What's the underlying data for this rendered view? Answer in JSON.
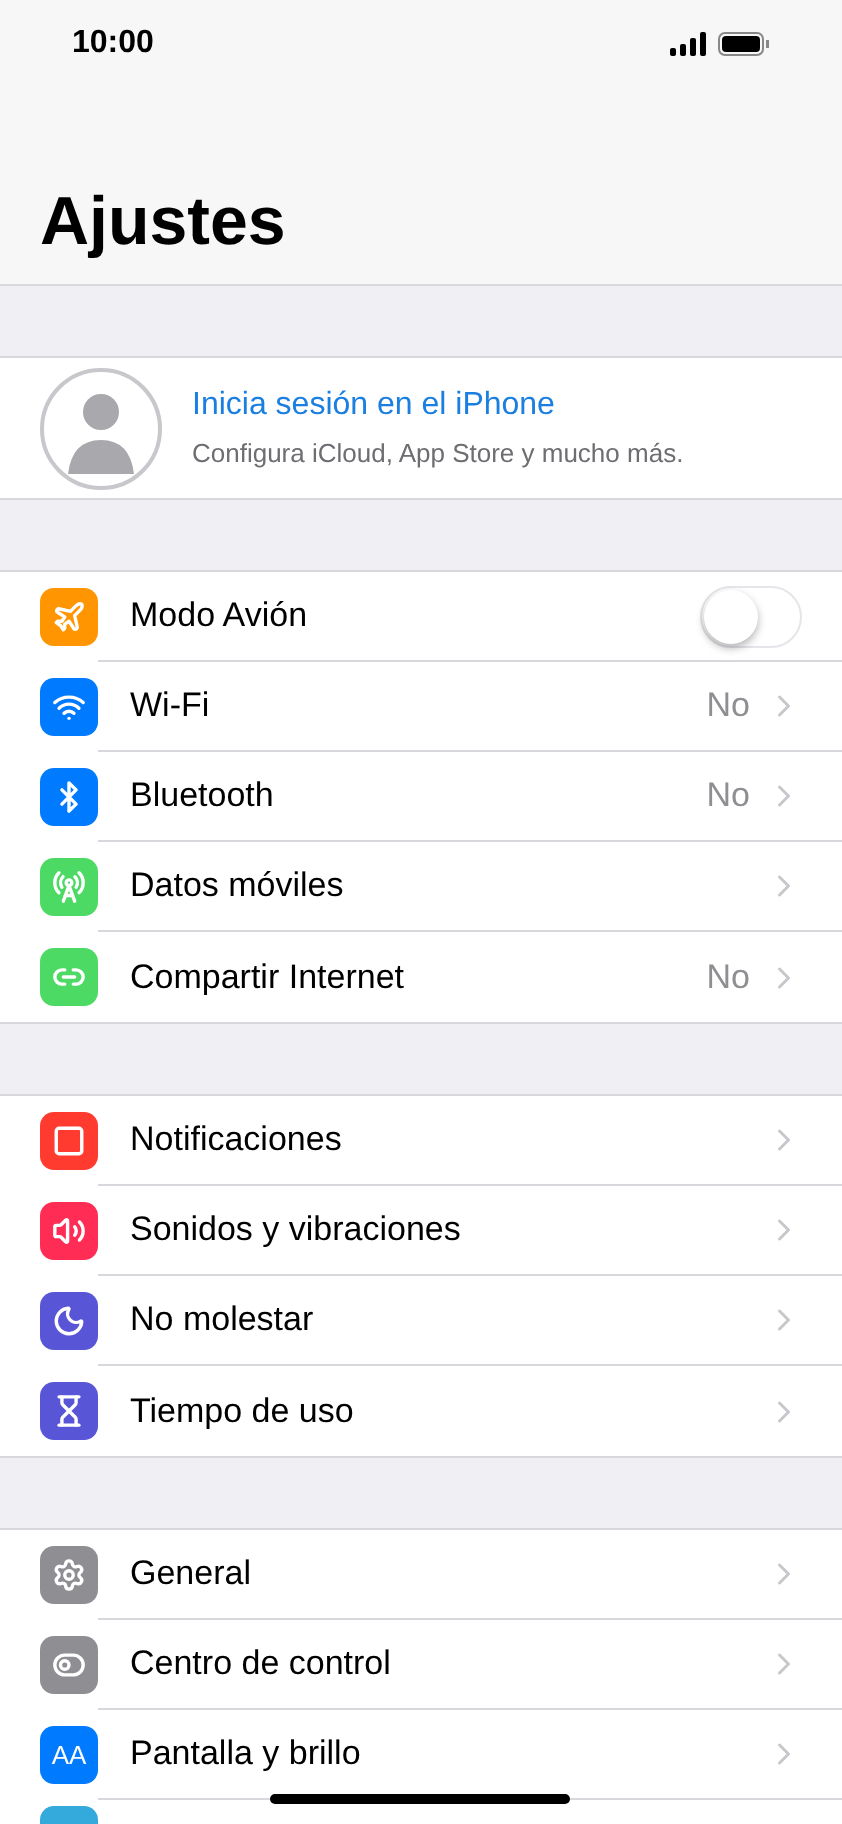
{
  "status_bar": {
    "time": "10:00"
  },
  "title": "Ajustes",
  "account": {
    "title": "Inicia sesión en el iPhone",
    "subtitle": "Configura iCloud, App Store y mucho más."
  },
  "sections": [
    {
      "items": [
        {
          "kind": "toggle",
          "label": "Modo Avión",
          "on": false,
          "color": "#ff9500"
        },
        {
          "kind": "link",
          "label": "Wi-Fi",
          "value": "No",
          "color": "#007aff"
        },
        {
          "kind": "link",
          "label": "Bluetooth",
          "value": "No",
          "color": "#007aff"
        },
        {
          "kind": "link",
          "label": "Datos móviles",
          "color": "#4cd964"
        },
        {
          "kind": "link",
          "label": "Compartir Internet",
          "value": "No",
          "color": "#4cd964"
        }
      ]
    },
    {
      "items": [
        {
          "kind": "link",
          "label": "Notificaciones",
          "color": "#ff3b30"
        },
        {
          "kind": "link",
          "label": "Sonidos y vibraciones",
          "color": "#ff2d55"
        },
        {
          "kind": "link",
          "label": "No molestar",
          "color": "#5856d6"
        },
        {
          "kind": "link",
          "label": "Tiempo de uso",
          "color": "#5856d6"
        }
      ]
    },
    {
      "items": [
        {
          "kind": "link",
          "label": "General",
          "color": "#8e8e93"
        },
        {
          "kind": "link",
          "label": "Centro de control",
          "color": "#8e8e93"
        },
        {
          "kind": "link",
          "label": "Pantalla y brillo",
          "icon_text": "AA",
          "color": "#007aff"
        },
        {
          "kind": "partial",
          "color": "#34aadc"
        }
      ]
    }
  ]
}
